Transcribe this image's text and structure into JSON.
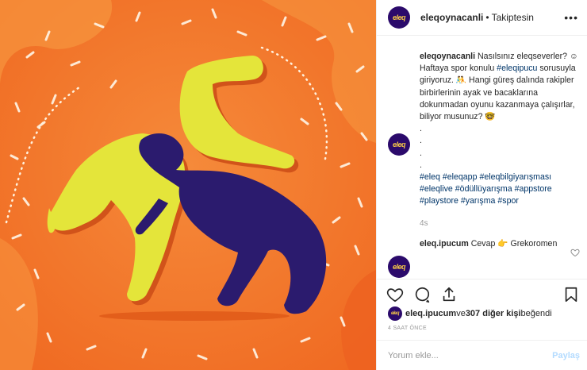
{
  "post": {
    "username": "eleqoynacanli",
    "follow_status": "Takiptesin",
    "avatar_text": "eleq",
    "image_alt": "wrestlers illustration"
  },
  "caption": {
    "username": "eleqoynacanli",
    "line1": " Nasılsınız eleqseverler? ☺ Haftaya spor konulu ",
    "tag_ipucu": "#eleqipucu",
    "line2": " sorusuyla giriyoruz. 🤼 Hangi güreş dalında rakipler birbirlerinin ayak ve bacaklarına dokunmadan oyunu kazanmaya çalışırlar, biliyor musunuz? 🤓\n.\n.\n.\n.\n",
    "hashtags": [
      "#eleq",
      "#eleqapp",
      "#eleqbilgiyarışması",
      "#eleqlive",
      "#ödüllüyarışma",
      "#appstore",
      "#playstore",
      "#yarışma",
      "#spor"
    ],
    "time_ago": "4s"
  },
  "reply": {
    "username": "eleq.ipucum",
    "text": " Cevap 👉 Grekoromen"
  },
  "likes": {
    "first_user": "eleq.ipucum",
    "connector": " ve ",
    "others": "307 diğer kişi",
    "suffix": " beğendi"
  },
  "post_time": "4 SAAT ÖNCE",
  "comment_input": {
    "placeholder": "Yorum ekle...",
    "post_label": "Paylaş"
  },
  "icons": {
    "more": "more-icon",
    "like": "heart-icon",
    "comment": "comment-icon",
    "share": "share-icon",
    "save": "bookmark-icon"
  },
  "colors": {
    "image_bg": "#f37a2c",
    "figure_yellow": "#e4e53a",
    "figure_navy": "#2b1b6e",
    "hashtag": "#003569",
    "muted": "#999999"
  }
}
